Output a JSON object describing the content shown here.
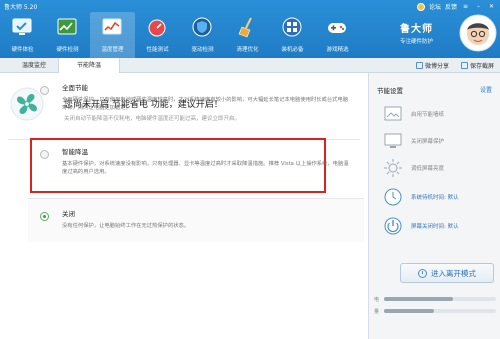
{
  "app": {
    "title": "鲁大师 5.20"
  },
  "nav": {
    "items": [
      {
        "label": "硬件体检",
        "icon": "monitor-check-icon",
        "active": false
      },
      {
        "label": "硬件检测",
        "icon": "hardware-chart-icon",
        "active": false
      },
      {
        "label": "温度管理",
        "icon": "temperature-chart-icon",
        "active": true
      },
      {
        "label": "性能测试",
        "icon": "speedometer-icon",
        "active": false
      },
      {
        "label": "驱动检测",
        "icon": "driver-shield-icon",
        "active": false
      },
      {
        "label": "清理优化",
        "icon": "broom-icon",
        "active": false
      },
      {
        "label": "装机必备",
        "icon": "app-store-icon",
        "active": false
      },
      {
        "label": "游戏精选",
        "icon": "gamepad-icon",
        "active": false
      }
    ]
  },
  "window": {
    "forum": "论坛",
    "feedback": "反馈"
  },
  "brand": {
    "name": "鲁大师",
    "slogan": "专注硬件防护"
  },
  "subtabs": {
    "tab1": "温度监控",
    "tab2": "节能降温"
  },
  "subright": {
    "share": "微博分享",
    "screenshot": "保存截屏"
  },
  "main": {
    "headline": "您尚未开启 节能省电 功能，建议开启！",
    "subline": "关闭自动节能降温不仅耗电，电脑硬件温度还可能过高，建议立即开启。",
    "options": [
      {
        "title": "全面节能",
        "desc": "全面硬件保护，只有使用电池或硬件温度较高时，才对系统速度有较小的影响，可大幅延长笔记本电脑使用时长或台式电脑寿命，同时让电脑更加稳定。",
        "selected": false
      },
      {
        "title": "智能降温",
        "desc": "基本硬件保护，对系统速度没有影响，只有处理器、显卡等温度过高时才采取降温措施。推荐 Vista 以上操作系统，电脑温度过高的用户选用。",
        "selected": false
      },
      {
        "title": "关闭",
        "desc": "没有任何保护，让电脑始终工作在无过热保护的状态。",
        "selected": true
      }
    ]
  },
  "sidebar": {
    "heading": "节能设置",
    "settings_link": "设置",
    "items": [
      {
        "label": "启用节能墙纸",
        "icon": "image-icon",
        "highlight": false
      },
      {
        "label": "关闭屏幕保护",
        "icon": "monitor-icon",
        "highlight": false
      },
      {
        "label": "调低屏幕亮度",
        "icon": "brightness-icon",
        "highlight": false
      },
      {
        "label": "系统待机时间: 默认",
        "icon": "clock-icon",
        "highlight": true
      },
      {
        "label": "屏幕关闭时间: 默认",
        "icon": "power-icon",
        "highlight": true
      }
    ],
    "quit_button": "进入离开模式",
    "meters": [
      {
        "label": "电",
        "value": 0.62
      },
      {
        "label": "量",
        "value": 0.45
      }
    ]
  },
  "colors": {
    "topbar": "#1f7cc4",
    "accent": "#2a7dc8",
    "highlight_box": "#d9241d",
    "radio_on": "#3aa53a"
  }
}
